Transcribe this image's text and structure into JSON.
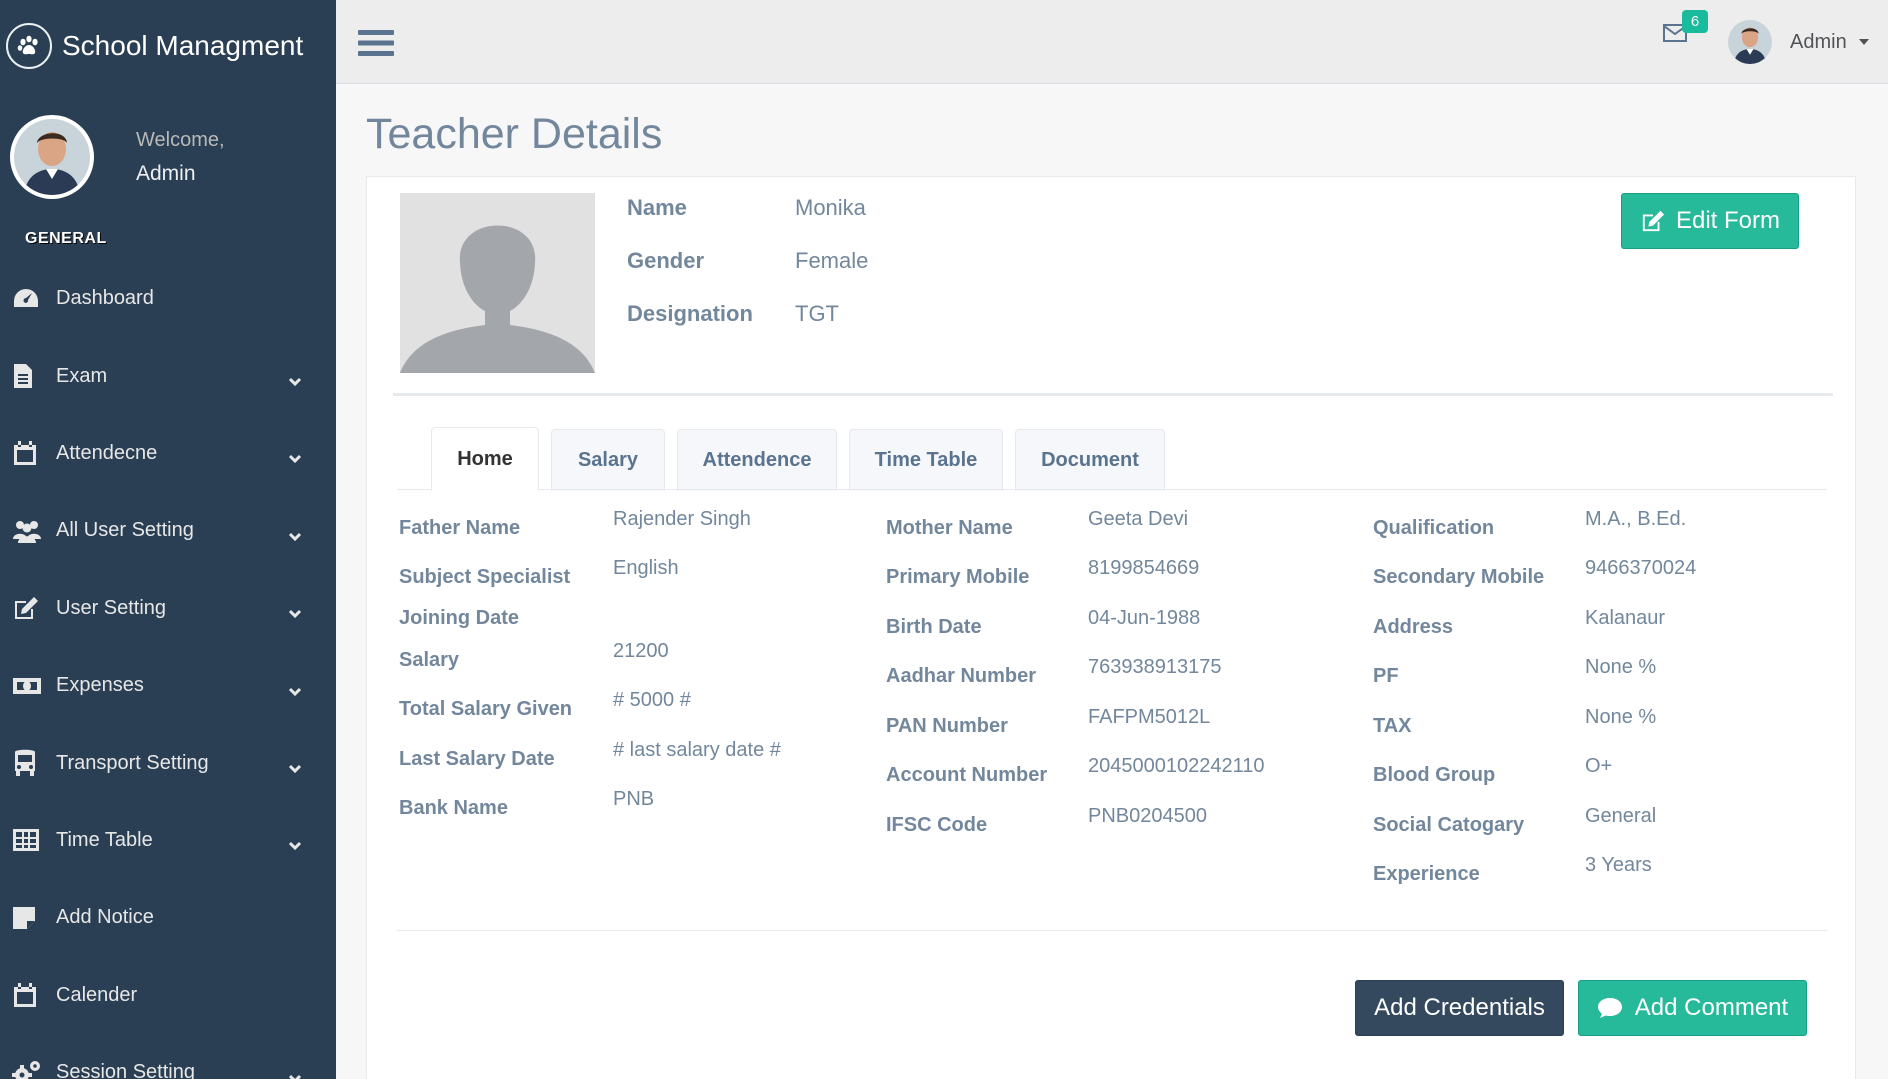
{
  "app": {
    "title": "School Managment"
  },
  "profile": {
    "welcome": "Welcome,",
    "name": "Admin"
  },
  "sidebar": {
    "section": "GENERAL",
    "items": [
      {
        "label": "Dashboard",
        "icon": "dashboard-icon",
        "expandable": false
      },
      {
        "label": "Exam",
        "icon": "file-icon",
        "expandable": true
      },
      {
        "label": "Attendecne",
        "icon": "calendar-icon",
        "expandable": true
      },
      {
        "label": "All User Setting",
        "icon": "users-icon",
        "expandable": true
      },
      {
        "label": "User Setting",
        "icon": "edit-icon",
        "expandable": true
      },
      {
        "label": "Expenses",
        "icon": "money-icon",
        "expandable": true
      },
      {
        "label": "Transport Setting",
        "icon": "bus-icon",
        "expandable": true
      },
      {
        "label": "Time Table",
        "icon": "table-icon",
        "expandable": true
      },
      {
        "label": "Add Notice",
        "icon": "sticky-note-icon",
        "expandable": false
      },
      {
        "label": "Calender",
        "icon": "calendar-icon",
        "expandable": false
      },
      {
        "label": "Session Setting",
        "icon": "cogs-icon",
        "expandable": true
      }
    ]
  },
  "topnav": {
    "mail_count": "6",
    "user_name": "Admin"
  },
  "page": {
    "title": "Teacher Details"
  },
  "teacher": {
    "basic": [
      {
        "label": "Name",
        "value": "Monika"
      },
      {
        "label": "Gender",
        "value": "Female"
      },
      {
        "label": "Designation",
        "value": "TGT"
      }
    ],
    "edit_label": "Edit Form"
  },
  "tabs": [
    {
      "label": "Home",
      "active": true
    },
    {
      "label": "Salary",
      "active": false
    },
    {
      "label": "Attendence",
      "active": false
    },
    {
      "label": "Time Table",
      "active": false
    },
    {
      "label": "Document",
      "active": false
    }
  ],
  "details": {
    "col1": [
      {
        "label": "Father Name",
        "value": "Rajender Singh"
      },
      {
        "label": "Subject Specialist",
        "value": "English"
      },
      {
        "label": "Joining Date",
        "value": ""
      },
      {
        "label": "Salary",
        "value": "21200"
      },
      {
        "label": "Total Salary Given",
        "value": "# 5000 #"
      },
      {
        "label": "Last Salary Date",
        "value": "# last salary date #"
      },
      {
        "label": "Bank Name",
        "value": "PNB"
      }
    ],
    "col2": [
      {
        "label": "Mother Name",
        "value": "Geeta Devi"
      },
      {
        "label": "Primary Mobile",
        "value": "8199854669"
      },
      {
        "label": "Birth Date",
        "value": "04-Jun-1988"
      },
      {
        "label": "Aadhar Number",
        "value": "763938913175"
      },
      {
        "label": "PAN Number",
        "value": "FAFPM5012L"
      },
      {
        "label": "Account Number",
        "value": "2045000102242110"
      },
      {
        "label": "IFSC Code",
        "value": "PNB0204500"
      }
    ],
    "col3": [
      {
        "label": "Qualification",
        "value": "M.A., B.Ed."
      },
      {
        "label": "Secondary Mobile",
        "value": "9466370024"
      },
      {
        "label": "Address",
        "value": "Kalanaur"
      },
      {
        "label": "PF",
        "value": "None %"
      },
      {
        "label": "TAX",
        "value": "None %"
      },
      {
        "label": "Blood Group",
        "value": "O+"
      },
      {
        "label": "Social Catogary",
        "value": "General"
      },
      {
        "label": "Experience",
        "value": "3 Years"
      }
    ]
  },
  "actions": {
    "credentials": "Add Credentials",
    "comment": "Add Comment"
  },
  "colors": {
    "sidebar": "#2a3f54",
    "accent": "#26b99a",
    "dark_button": "#34495e",
    "text": "#73879c"
  }
}
